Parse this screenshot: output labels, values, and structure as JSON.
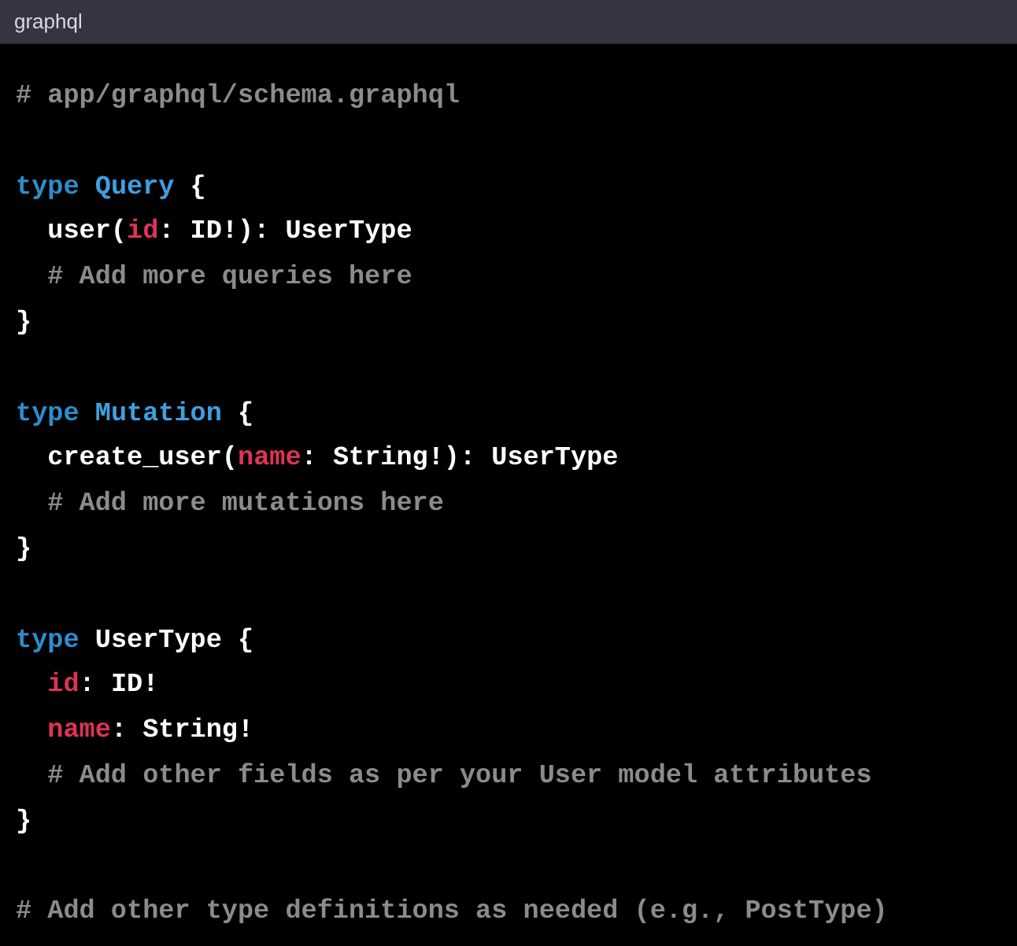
{
  "header": {
    "language": "graphql"
  },
  "code_blocks": [
    {
      "lines": [
        [
          {
            "kind": "comment",
            "text": "# app/graphql/schema.graphql"
          }
        ]
      ]
    },
    {
      "lines": [
        [
          {
            "kind": "keyword",
            "text": "type"
          },
          {
            "kind": "type_name",
            "text": " Query"
          },
          {
            "kind": "plain",
            "text": " {"
          }
        ],
        [
          {
            "kind": "plain",
            "text": "  user("
          },
          {
            "kind": "argument",
            "text": "id"
          },
          {
            "kind": "plain",
            "text": ": ID!): UserType"
          }
        ],
        [
          {
            "kind": "comment",
            "text": "  # Add more queries here"
          }
        ],
        [
          {
            "kind": "plain",
            "text": "}"
          }
        ]
      ]
    },
    {
      "lines": [
        [
          {
            "kind": "keyword",
            "text": "type"
          },
          {
            "kind": "type_name",
            "text": " Mutation"
          },
          {
            "kind": "plain",
            "text": " {"
          }
        ],
        [
          {
            "kind": "plain",
            "text": "  create_user("
          },
          {
            "kind": "argument",
            "text": "name"
          },
          {
            "kind": "plain",
            "text": ": String!): UserType"
          }
        ],
        [
          {
            "kind": "comment",
            "text": "  # Add more mutations here"
          }
        ],
        [
          {
            "kind": "plain",
            "text": "}"
          }
        ]
      ]
    },
    {
      "lines": [
        [
          {
            "kind": "keyword",
            "text": "type"
          },
          {
            "kind": "plain",
            "text": " UserType {"
          }
        ],
        [
          {
            "kind": "argument",
            "text": "  id"
          },
          {
            "kind": "plain",
            "text": ": ID!"
          }
        ],
        [
          {
            "kind": "argument",
            "text": "  name"
          },
          {
            "kind": "plain",
            "text": ": String!"
          }
        ],
        [
          {
            "kind": "comment",
            "text": "  # Add other fields as per your User model attributes"
          }
        ],
        [
          {
            "kind": "plain",
            "text": "}"
          }
        ]
      ]
    },
    {
      "lines": [
        [
          {
            "kind": "comment",
            "text": "# Add other type definitions as needed (e.g., PostType)"
          }
        ]
      ]
    }
  ]
}
